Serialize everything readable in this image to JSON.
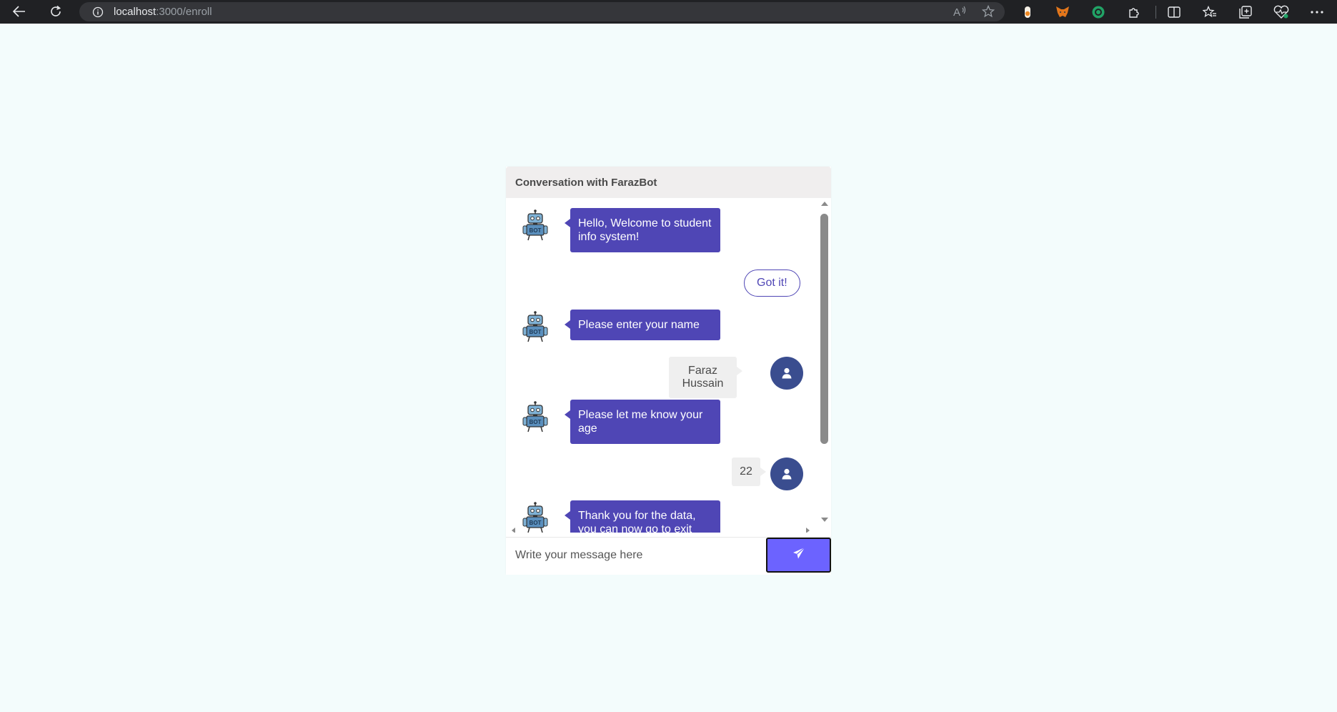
{
  "browser": {
    "url_host": "localhost",
    "url_path": ":3000/enroll",
    "icons": [
      "back-icon",
      "reload-icon",
      "info-icon",
      "read-aloud-icon",
      "favorite-star-icon",
      "extension-orange-icon",
      "metamask-fox-icon",
      "extension-green-ring-icon",
      "extensions-puzzle-icon",
      "split-screen-icon",
      "favorites-icon",
      "collections-icon",
      "browser-essentials-icon",
      "more-menu-icon"
    ]
  },
  "chat": {
    "header_title": "Conversation with FarazBot",
    "messages": [
      {
        "from": "bot",
        "text": "Hello, Welcome to student info system!"
      },
      {
        "from": "option",
        "text": "Got it!"
      },
      {
        "from": "bot",
        "text": "Please enter your name"
      },
      {
        "from": "user",
        "text": "Faraz Hussain"
      },
      {
        "from": "bot",
        "text": "Please let me know your age"
      },
      {
        "from": "user",
        "text": "22"
      },
      {
        "from": "bot",
        "text": "Thank you for the data, you can now go to exit"
      }
    ],
    "input_placeholder": "Write your message here",
    "colors": {
      "bot_bubble": "#4f46b5",
      "send_button": "#6c63ff",
      "user_avatar": "#3a4d8f"
    }
  }
}
